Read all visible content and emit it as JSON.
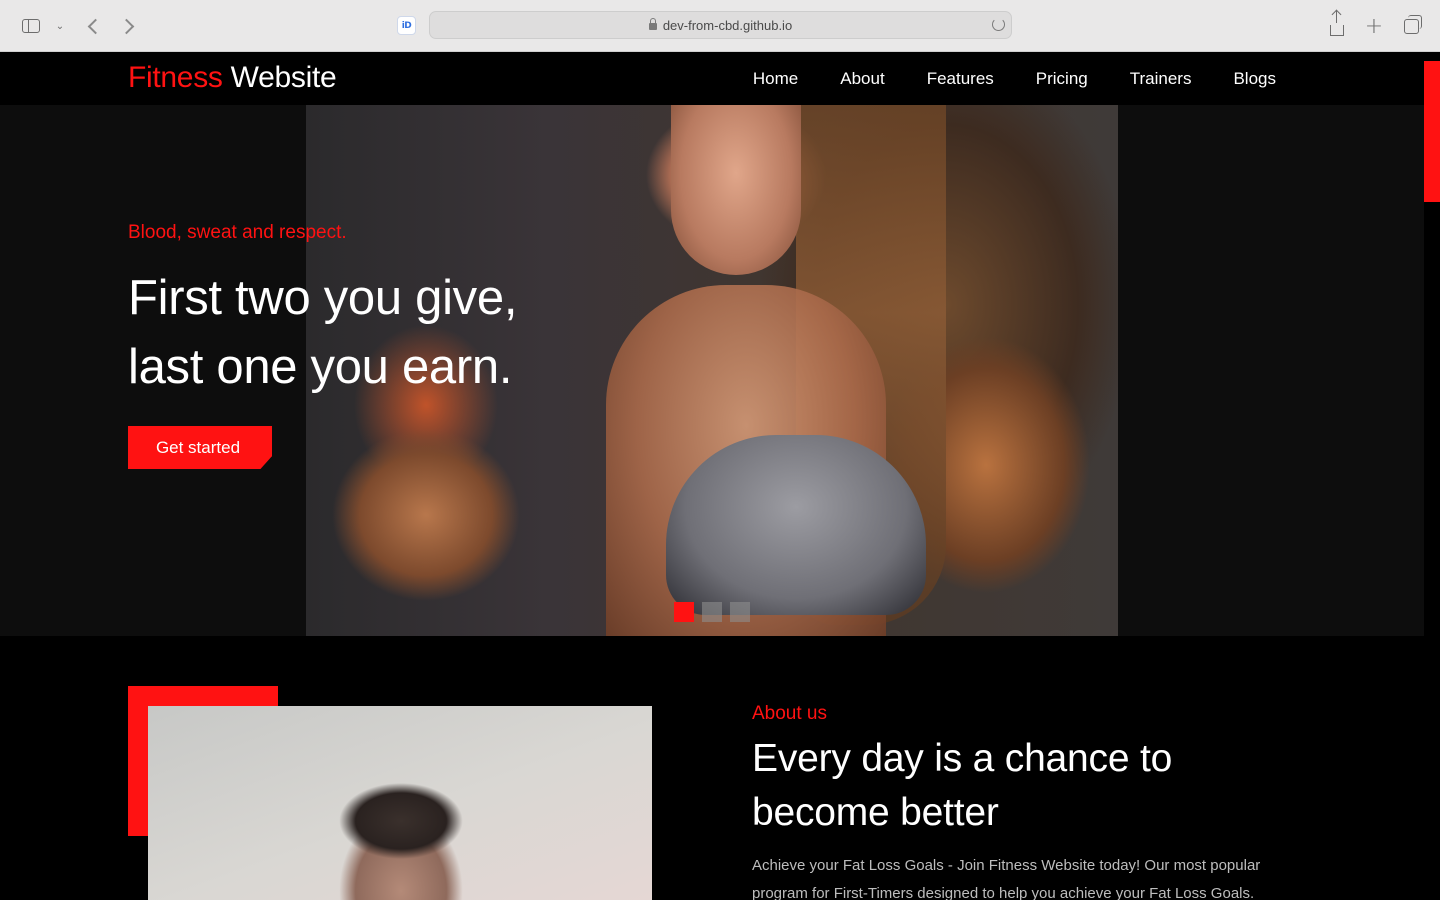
{
  "browser": {
    "url": "dev-from-cbd.github.io",
    "favicon_text": "iD"
  },
  "site": {
    "brand_part1": "Fitness",
    "brand_part2": "Website",
    "brand_colors": {
      "accent": "#ff1212",
      "text": "#ffffff",
      "background": "#000000"
    },
    "nav": [
      {
        "label": "Home"
      },
      {
        "label": "About"
      },
      {
        "label": "Features"
      },
      {
        "label": "Pricing"
      },
      {
        "label": "Trainers"
      },
      {
        "label": "Blogs"
      }
    ]
  },
  "hero": {
    "tagline": "Blood, sweat and respect.",
    "heading_line1": "First two you give,",
    "heading_line2": "last one you earn.",
    "cta_label": "Get started",
    "carousel": {
      "slides": 3,
      "active_slide": 1
    }
  },
  "about": {
    "label": "About us",
    "heading_line1": "Every day is a chance to",
    "heading_line2": "become better",
    "body": "Achieve your Fat Loss Goals - Join Fitness Website today! Our most popular program for First-Timers designed to help you achieve your Fat Loss Goals."
  }
}
